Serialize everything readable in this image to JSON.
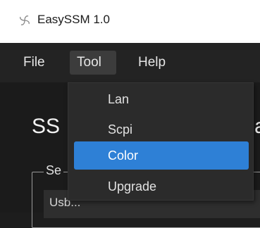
{
  "window": {
    "title": "EasySSM 1.0",
    "icon": "easyssm-pinwheel-icon"
  },
  "menubar": {
    "items": [
      {
        "label": "File"
      },
      {
        "label": "Tool"
      },
      {
        "label": "Help"
      }
    ],
    "active": "Tool"
  },
  "tool_menu": {
    "items": [
      {
        "label": "Lan"
      },
      {
        "label": "Scpi"
      },
      {
        "label": "Color",
        "highlighted": true
      },
      {
        "label": "Upgrade"
      }
    ]
  },
  "main": {
    "heading_left": "SS",
    "heading_right": "a",
    "group_label": "Se",
    "field_text": "Usb..."
  },
  "colors": {
    "menu_background": "#2b2b2b",
    "highlight": "#2e80d6",
    "app_background": "#1b1b1b",
    "titlebar": "#ffffff"
  }
}
